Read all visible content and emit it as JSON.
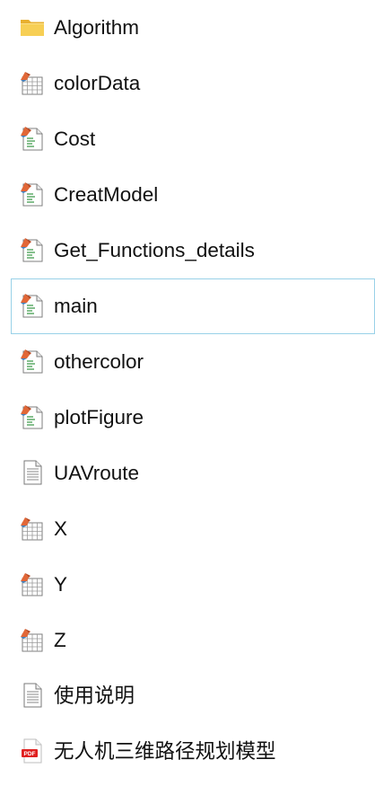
{
  "files": [
    {
      "name": "Algorithm",
      "icon": "folder-icon"
    },
    {
      "name": "colorData",
      "icon": "matlab-data-icon"
    },
    {
      "name": "Cost",
      "icon": "matlab-script-icon"
    },
    {
      "name": "CreatModel",
      "icon": "matlab-script-icon"
    },
    {
      "name": "Get_Functions_details",
      "icon": "matlab-script-icon"
    },
    {
      "name": "main",
      "icon": "matlab-script-icon",
      "selected": true
    },
    {
      "name": "othercolor",
      "icon": "matlab-script-icon"
    },
    {
      "name": "plotFigure",
      "icon": "matlab-script-icon"
    },
    {
      "name": "UAVroute",
      "icon": "text-file-icon"
    },
    {
      "name": "X",
      "icon": "matlab-data-icon"
    },
    {
      "name": "Y",
      "icon": "matlab-data-icon"
    },
    {
      "name": "Z",
      "icon": "matlab-data-icon"
    },
    {
      "name": "使用说明",
      "icon": "text-file-icon"
    },
    {
      "name": "无人机三维路径规划模型",
      "icon": "pdf-file-icon"
    }
  ],
  "colors": {
    "selection_border": "#99d1e8",
    "folder": "#f4c544",
    "pdf_red": "#e02020",
    "matlab_orange": "#e16737"
  }
}
